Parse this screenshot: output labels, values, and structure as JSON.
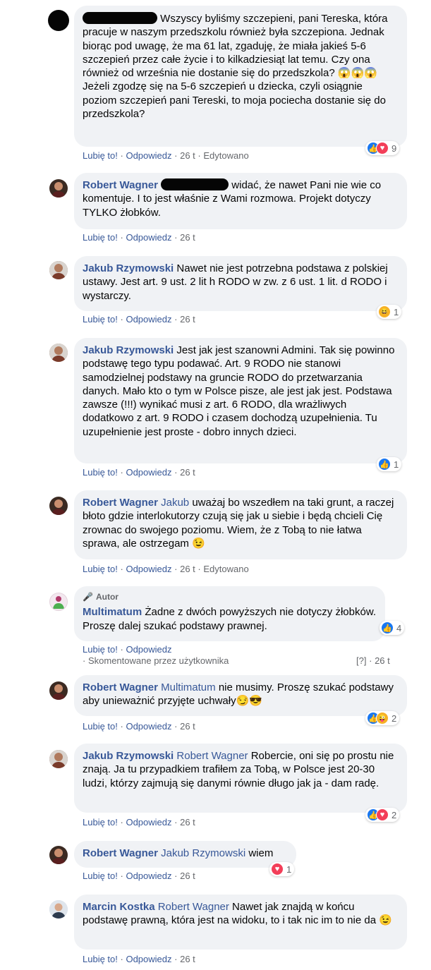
{
  "labels": {
    "like": "Lubię to!",
    "reply": "Odpowiedz",
    "edited": "Edytowano",
    "dot": "·",
    "author": "Autor",
    "commented_by": "Skomentowane przez użytkownika",
    "question": "[?]"
  },
  "colors": {
    "bubble": "#f0f2f5",
    "link": "#385898",
    "meta": "#65676b",
    "like_blue": "#1877f2",
    "love_red": "#f33e58"
  },
  "comments": [
    {
      "id": "c1",
      "text": "Wszyscy byliśmy szczepieni, pani Tereska, która pracuje w naszym przedszkolu również była szczepiona. Jednak biorąc pod uwagę, że ma 61 lat, zgaduję, że miała jakieś 5-6 szczepień przez całe życie i to kilkadziesiąt lat temu. Czy ona również od września nie dostanie się do przedszkola? 😱😱😱\nJeżeli zgodzę się na 5-6 szczepień u dziecka, czyli osiągnie poziom szczepień pani Tereski, to moja pociecha dostanie się do przedszkola?",
      "time": "26 t",
      "edited": true,
      "reactions": {
        "types": [
          "like",
          "love"
        ],
        "count": "9"
      }
    },
    {
      "id": "c2",
      "author": "Robert Wagner",
      "text": "widać, że nawet Pani nie wie co komentuje. I to jest właśnie z Wami rozmowa. Projekt dotyczy TYLKO żłobków.",
      "time": "26 t"
    },
    {
      "id": "c3",
      "author": "Jakub Rzymowski",
      "text": "Nawet nie jest potrzebna podstawa z polskiej ustawy. Jest art. 9 ust. 2 lit h RODO w zw. z 6 ust. 1 lit. d RODO i wystarczy.",
      "time": "26 t",
      "reactions": {
        "types": [
          "haha"
        ],
        "count": "1"
      }
    },
    {
      "id": "c4",
      "author": "Jakub Rzymowski",
      "text": "Jest jak jest szanowni Admini. Tak się powinno podstawę tego typu podawać. Art. 9 RODO nie stanowi samodzielnej podstawy na gruncie RODO do przetwarzania danych. Mało kto o tym w Polsce pisze, ale jest jak jest. Podstawa zawsze (!!!) wynikać musi z art. 6 RODO, dla wrażliwych dodatkowo z art. 9 RODO i czasem dochodzą uzupełnienia. Tu uzupełnienie jest proste - dobro innych dzieci.",
      "time": "26 t",
      "reactions": {
        "types": [
          "like"
        ],
        "count": "1"
      }
    },
    {
      "id": "c5",
      "author": "Robert Wagner",
      "mention": "Jakub",
      "text": "uważaj bo wszedłem na taki grunt, a raczej błoto gdzie interlokutorzy czują się jak u siebie i będą chcieli Cię zrownac do swojego poziomu. Wiem, że z Tobą to nie łatwa sprawa, ale ostrzegam 😉",
      "time": "26 t",
      "edited": true
    },
    {
      "id": "c6",
      "author": "Multimatum",
      "badge": "Autor",
      "text": "Żadne z dwóch powyższych nie dotyczy żłobków. Proszę dalej szukać podstawy prawnej.",
      "time": "26 t",
      "reactions": {
        "types": [
          "like"
        ],
        "count": "4"
      }
    },
    {
      "id": "c7",
      "author": "Robert Wagner",
      "mention": "Multimatum",
      "text": "nie musimy. Proszę szukać podstawy aby unieważnić przyjęte uchwały😏😎",
      "time": "26 t",
      "reactions": {
        "types": [
          "like",
          "haha"
        ],
        "count": "2"
      }
    },
    {
      "id": "c8",
      "author": "Jakub Rzymowski",
      "mention": "Robert Wagner",
      "text": "Robercie, oni się po prostu nie znają. Ja tu przypadkiem trafiłem za Tobą, w Polsce jest 20-30 ludzi, którzy zajmują się danymi równie długo jak ja - dam radę.",
      "time": "26 t",
      "reactions": {
        "types": [
          "like",
          "love"
        ],
        "count": "2"
      }
    },
    {
      "id": "c9",
      "author": "Robert Wagner",
      "mention": "Jakub Rzymowski",
      "text": "wiem",
      "time": "26 t",
      "reactions": {
        "types": [
          "love"
        ],
        "count": "1"
      }
    },
    {
      "id": "c10",
      "author": "Marcin Kostka",
      "mention": "Robert Wagner",
      "text": "Nawet jak znajdą w końcu podstawę prawną, która jest na widoku, to i tak nic im to nie da 😉",
      "time": "26 t"
    }
  ]
}
